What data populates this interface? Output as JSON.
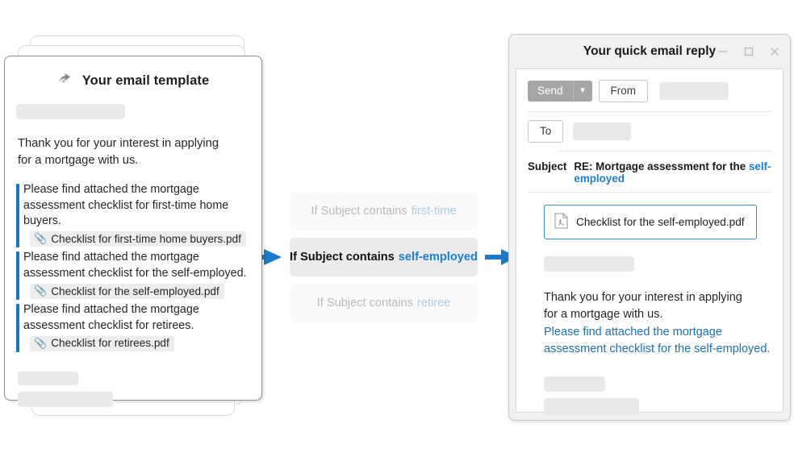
{
  "template_card": {
    "icon": "reply-arrow-icon",
    "title": "Your email template",
    "intro": "Thank you for your interest in applying\nfor a mortgage with us.",
    "blocks": [
      {
        "text": "Please find attached the mortgage assessment checklist for first-time home buyers.",
        "attachment": "Checklist for first-time home buyers.pdf",
        "attachment_icon": "paperclip-icon"
      },
      {
        "text": "Please find attached the mortgage assessment checklist for the self-employed.",
        "attachment": "Checklist for the self-employed.pdf",
        "attachment_icon": "paperclip-icon"
      },
      {
        "text": "Please find attached the mortgage assessment checklist for retirees.",
        "attachment": "Checklist for retirees.pdf",
        "attachment_icon": "paperclip-icon"
      }
    ]
  },
  "conditions": [
    {
      "prefix": "If Subject contains",
      "keyword": "first-time",
      "state": "inactive"
    },
    {
      "prefix": "If Subject contains",
      "keyword": "self-employed",
      "state": "active"
    },
    {
      "prefix": "If Subject contains",
      "keyword": "retiree",
      "state": "inactive"
    }
  ],
  "reply_window": {
    "title": "Your quick email reply",
    "controls": {
      "minimize": "minimize-icon",
      "maximize": "maximize-icon",
      "close": "close-icon"
    },
    "toolbar": {
      "send_label": "Send",
      "send_caret_icon": "chevron-down-icon",
      "from_label": "From",
      "to_label": "To"
    },
    "subject": {
      "label": "Subject",
      "value": "RE: Mortgage assessment for the",
      "keyword": "self-employed"
    },
    "attachment": {
      "icon": "pdf-file-icon",
      "name": "Checklist for the self-employed.pdf"
    },
    "body": {
      "plain": "Thank you for your interest in applying\nfor a mortgage with us.",
      "highlighted": "Please find attached the mortgage\nassessment checklist for the self-employed."
    }
  },
  "colors": {
    "accent_blue": "#1b7fd4",
    "template_bar_blue": "#1577c6",
    "arrow_blue": "#1a7ac8",
    "muted_text": "#b9b9b9",
    "placeholder_gray": "#e9e9e9",
    "send_button_gray": "#a6a6a6"
  },
  "arrows": [
    {
      "name": "arrow-template-to-condition"
    },
    {
      "name": "arrow-condition-to-reply"
    }
  ]
}
